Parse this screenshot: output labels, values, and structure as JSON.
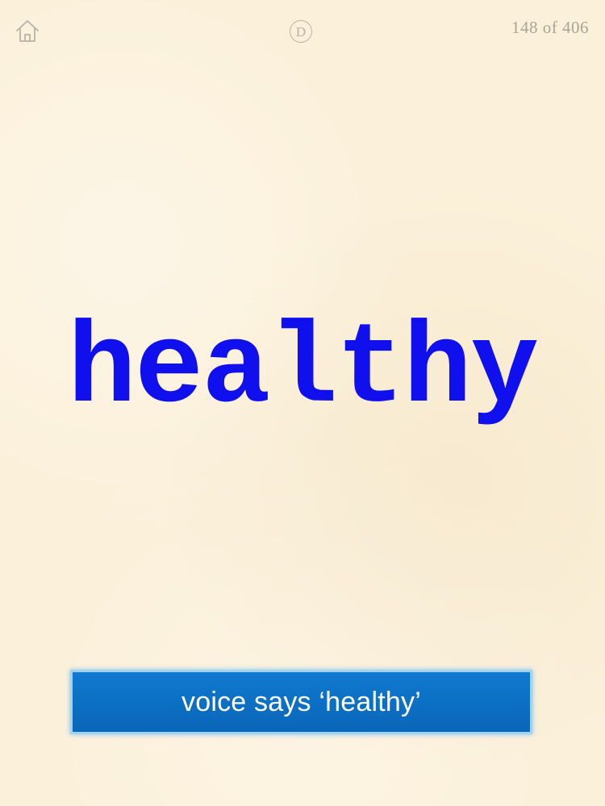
{
  "header": {
    "home_icon": "home-icon",
    "deck_letter": "D",
    "counter": "148 of 406"
  },
  "card": {
    "word": "healthy"
  },
  "voice_button": {
    "label": "voice says ‘healthy’"
  },
  "colors": {
    "background": "#fbf0d9",
    "word": "#1010ee",
    "button": "#0a6fc4",
    "button_border": "#9fd3f2",
    "chrome": "#b8b2a6"
  }
}
